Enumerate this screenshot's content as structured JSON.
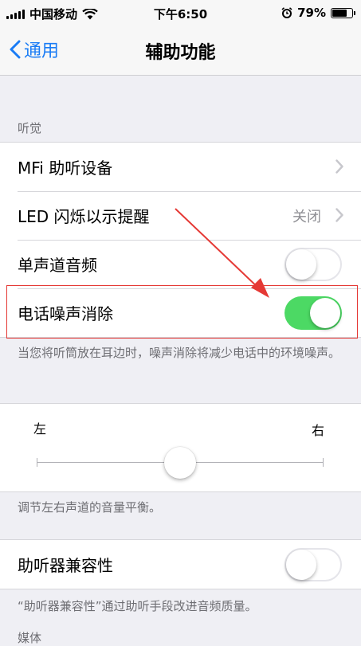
{
  "status_bar": {
    "carrier": "中国移动",
    "time": "下午6:50",
    "battery_percent": "79%",
    "battery_level": 0.79
  },
  "nav": {
    "back_label": "通用",
    "title": "辅助功能"
  },
  "hearing": {
    "header": "听觉",
    "rows": [
      {
        "label": "MFi 助听设备",
        "type": "chevron"
      },
      {
        "label": "LED 闪烁以示提醒",
        "detail": "关闭",
        "type": "chevron"
      },
      {
        "label": "单声道音频",
        "type": "toggle",
        "on": false
      },
      {
        "label": "电话噪声消除",
        "type": "toggle",
        "on": true
      }
    ],
    "footer": "当您将听筒放在耳边时，噪声消除将减少电话中的环境噪声。"
  },
  "balance": {
    "left_label": "左",
    "right_label": "右",
    "value": 0.5,
    "footer": "调节左右声道的音量平衡。"
  },
  "hearing_aid": {
    "label": "助听器兼容性",
    "on": false,
    "footer": "“助听器兼容性”通过助听手段改进音频质量。"
  },
  "next_section_header": "媒体",
  "colors": {
    "accent": "#1a7cf5",
    "toggle_on": "#4cd964",
    "annotation": "#e53935"
  }
}
